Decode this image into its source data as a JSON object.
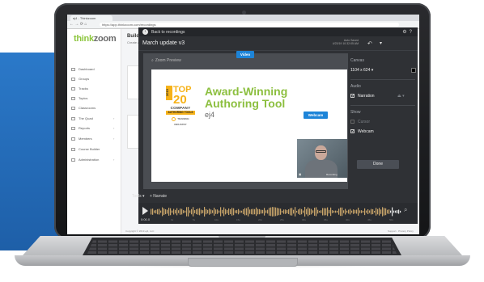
{
  "browser": {
    "tab_title": "ej4 - Thinkzoom",
    "nav_icons": "← → ⟳ ⌂",
    "url": "https://app.thinkzoom.com/recordings"
  },
  "app": {
    "logo_think": "think",
    "logo_zoom": "zoom",
    "nav": [
      {
        "label": "Dashboard",
        "chevron": ""
      },
      {
        "label": "Groups",
        "chevron": ""
      },
      {
        "label": "Tracks",
        "chevron": ""
      },
      {
        "label": "Topics",
        "chevron": ""
      },
      {
        "label": "Classrooms",
        "chevron": ""
      },
      {
        "label": "The Quad",
        "chevron": "›"
      },
      {
        "label": "Reports",
        "chevron": "›"
      },
      {
        "label": "Members",
        "chevron": "›"
      },
      {
        "label": "Course Builder",
        "chevron": ""
      },
      {
        "label": "Administration",
        "chevron": "›"
      }
    ],
    "page_title": "Build",
    "page_sub": "Create a r",
    "footer_left": "Copyright © 2019 ej4, LLC",
    "footer_right": "Support  ·  Privacy Policy"
  },
  "modal": {
    "back_label": "Back to recordings",
    "recording_title": "March update v3",
    "save_info_1": "Auto Saved",
    "save_info_2": "4/23/19 10:32:05 AM",
    "zoom_preview_label": "Zoom Preview",
    "video_tag": "Video",
    "webcam_tag": "Webcam",
    "recording_label": "Recording",
    "slide": {
      "badge_year": "2019",
      "badge_top": "TOP",
      "badge_num": "20",
      "badge_company": "COMPANY",
      "badge_bar": "AUTHORING TOOLS",
      "badge_ti": "TRAINING INDUSTRY",
      "headline": "Award-Winning Authoring Tool",
      "brand": "ej4"
    },
    "panel": {
      "canvas_head": "Canvas",
      "canvas_size": "1104 x 624 ▾",
      "audio_head": "Audio",
      "narration": "Narration",
      "narration_extra": "⏏ ▾",
      "show_head": "Show",
      "cursor": "Cursor",
      "webcam": "Webcam",
      "done": "Done"
    },
    "tools": {
      "left": "Tools ▾",
      "narrate": "+ Narrate"
    },
    "timeline": {
      "current_time": "0:00.0",
      "ticks": [
        "0s",
        "5s",
        "10s",
        "15s",
        "20s",
        "25s",
        "30s",
        "35s",
        "40s",
        "45s",
        "50s"
      ]
    }
  }
}
